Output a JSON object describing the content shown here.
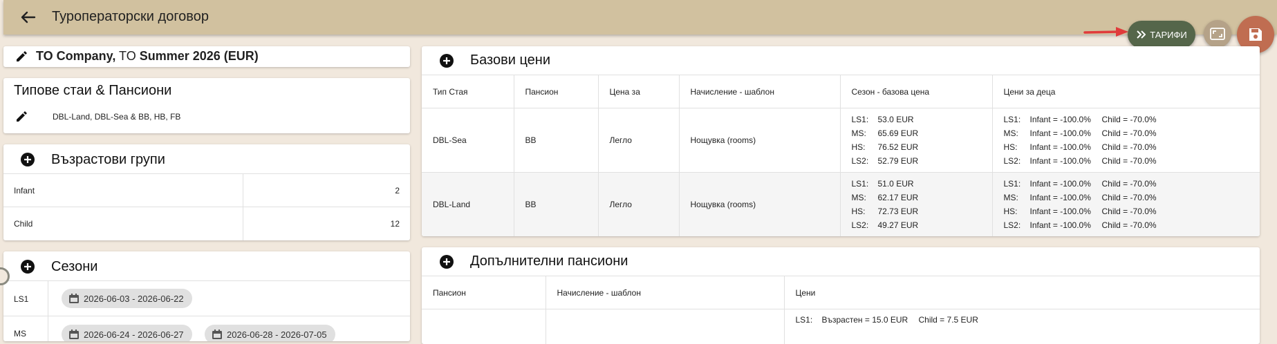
{
  "header": {
    "title": "Туроператорски договор"
  },
  "actions": {
    "tariffs_label": "ТАРИФИ"
  },
  "contract": {
    "company": "TO Company,",
    "to_prefix": "TO",
    "season_name": "Summer 2026 (EUR)"
  },
  "room_types": {
    "title": "Типове стаи & Пансиони",
    "summary": "DBL-Land, DBL-Sea & BB, HB, FB"
  },
  "age_groups": {
    "title": "Възрастови групи",
    "rows": [
      {
        "name": "Infant",
        "value": "2"
      },
      {
        "name": "Child",
        "value": "12"
      }
    ]
  },
  "seasons": {
    "title": "Сезони",
    "rows": [
      {
        "code": "LS1",
        "ranges": [
          "2026-06-03 - 2026-06-22"
        ]
      },
      {
        "code": "MS",
        "ranges": [
          "2026-06-24 - 2026-06-27",
          "2026-06-28 - 2026-07-05"
        ]
      }
    ]
  },
  "base_prices": {
    "title": "Базови цени",
    "headers": [
      "Тип Стая",
      "Пансион",
      "Цена за",
      "Начисление - шаблон",
      "Сезон - базова цена",
      "Цени за деца"
    ],
    "rows": [
      {
        "room": "DBL-Sea",
        "board": "BB",
        "price_for": "Легло",
        "template": "Нощувка (rooms)",
        "season_prices": [
          {
            "code": "LS1:",
            "price": "53.0 EUR"
          },
          {
            "code": "MS:",
            "price": "65.69 EUR"
          },
          {
            "code": "HS:",
            "price": "76.52 EUR"
          },
          {
            "code": "LS2:",
            "price": "52.79 EUR"
          }
        ],
        "child_prices": [
          {
            "code": "LS1:",
            "infant": "Infant = -100.0%",
            "child": "Child = -70.0%"
          },
          {
            "code": "MS:",
            "infant": "Infant = -100.0%",
            "child": "Child = -70.0%"
          },
          {
            "code": "HS:",
            "infant": "Infant = -100.0%",
            "child": "Child = -70.0%"
          },
          {
            "code": "LS2:",
            "infant": "Infant = -100.0%",
            "child": "Child = -70.0%"
          }
        ]
      },
      {
        "room": "DBL-Land",
        "board": "BB",
        "price_for": "Легло",
        "template": "Нощувка (rooms)",
        "season_prices": [
          {
            "code": "LS1:",
            "price": "51.0 EUR"
          },
          {
            "code": "MS:",
            "price": "62.17 EUR"
          },
          {
            "code": "HS:",
            "price": "72.73 EUR"
          },
          {
            "code": "LS2:",
            "price": "49.27 EUR"
          }
        ],
        "child_prices": [
          {
            "code": "LS1:",
            "infant": "Infant = -100.0%",
            "child": "Child = -70.0%"
          },
          {
            "code": "MS:",
            "infant": "Infant = -100.0%",
            "child": "Child = -70.0%"
          },
          {
            "code": "HS:",
            "infant": "Infant = -100.0%",
            "child": "Child = -70.0%"
          },
          {
            "code": "LS2:",
            "infant": "Infant = -100.0%",
            "child": "Child = -70.0%"
          }
        ]
      }
    ]
  },
  "extra_boards": {
    "title": "Допълнителни пансиони",
    "headers": [
      "Пансион",
      "Начисление - шаблон",
      "Цени"
    ],
    "first_row_prices": {
      "code": "LS1:",
      "adult": "Възрастен = 15.0 EUR",
      "child": "Child = 7.5 EUR"
    }
  },
  "colors": {
    "background": "#f1e8dd",
    "topbar": "#d1c19f",
    "tariff_button": "#55664a",
    "fullscreen_button": "#b5a288",
    "save_button": "#c06d51",
    "arrow": "#e03b3b"
  }
}
